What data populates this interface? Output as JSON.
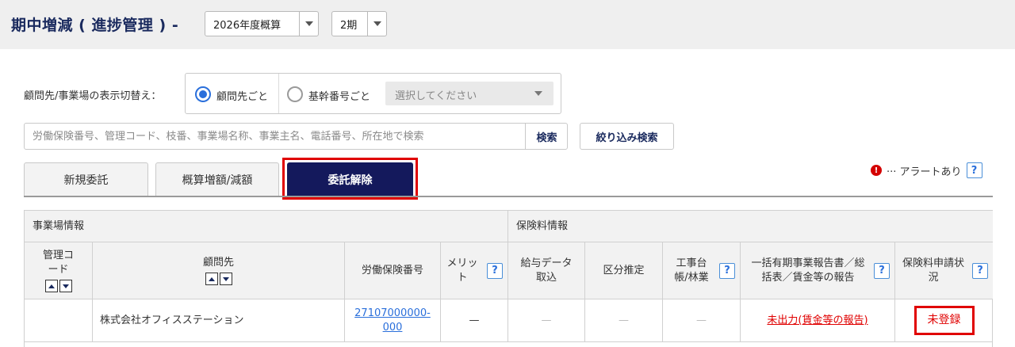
{
  "header": {
    "title": "期中増減 ( 進捗管理 ) -",
    "fiscal_select": "2026年度概算",
    "period_select": "2期"
  },
  "display_toggle": {
    "label": "顧問先/事業場の表示切替え：",
    "option_client": "顧問先ごと",
    "option_base": "基幹番号ごと",
    "base_placeholder": "選択してください"
  },
  "search": {
    "placeholder": "労働保険番号、管理コード、枝番、事業場名称、事業主名、電話番号、所在地で検索",
    "search_label": "検索",
    "filter_label": "絞り込み検索"
  },
  "tabs": [
    {
      "label": "新規委託"
    },
    {
      "label": "概算増額/減額"
    },
    {
      "label": "委託解除"
    }
  ],
  "alert_legend": {
    "icon": "!",
    "text": "··· アラートあり",
    "help": "?"
  },
  "table": {
    "group_business": "事業場情報",
    "group_insurance": "保険料情報",
    "col_code": "管理コード",
    "col_client": "顧問先",
    "col_labor_no": "労働保険番号",
    "col_merit": "メリット",
    "col_payroll": "給与データ取込",
    "col_class": "区分推定",
    "col_ledger": "工事台帳/林業",
    "col_report": "一括有期事業報告書／総括表／賃金等の報告",
    "col_status": "保険料申請状況",
    "help": "?",
    "row": {
      "code": "",
      "client": "株式会社オフィスステーション",
      "labor_no_1": "27107000000-",
      "labor_no_2": "000",
      "merit": "—",
      "payroll": "—",
      "class": "—",
      "ledger": "—",
      "report": "未出力(賃金等の報告)",
      "status": "未登録"
    }
  },
  "colors": {
    "navy": "#14195c",
    "accent_blue": "#2a6fdb",
    "alert_red": "#e00000"
  }
}
